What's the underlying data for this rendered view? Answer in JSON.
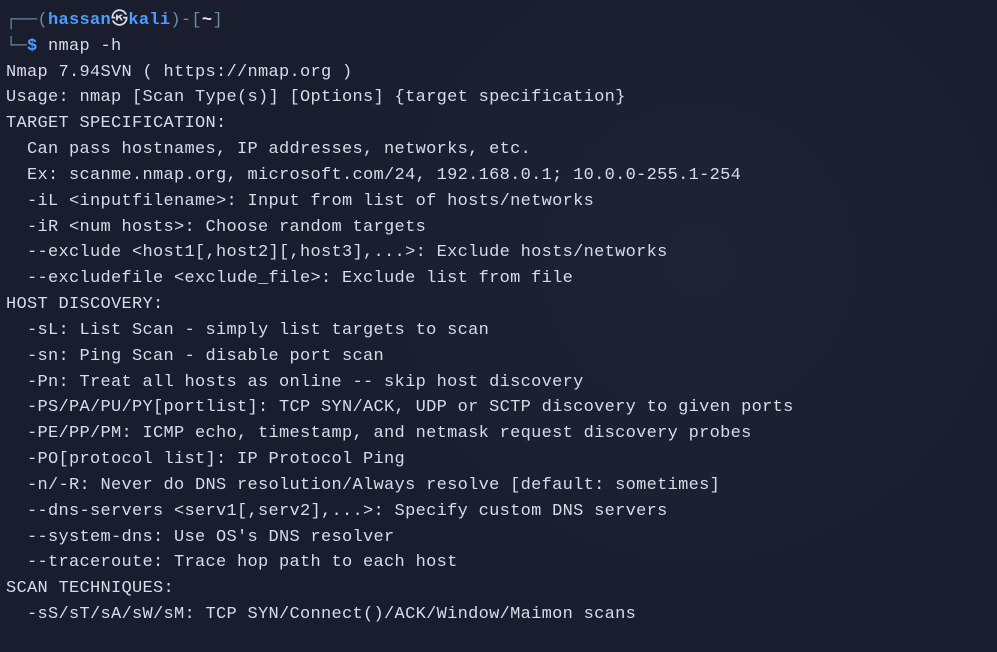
{
  "prompt": {
    "box_top_left": "┌──",
    "paren_open": "(",
    "user": "hassan",
    "skull": "㉿",
    "host": "kali",
    "paren_close": ")",
    "dash": "-",
    "brack_open": "[",
    "path": "~",
    "brack_close": "]",
    "box_bottom_left": "└─",
    "dollar": "$",
    "command": "nmap -h"
  },
  "output": {
    "l01": "Nmap 7.94SVN ( https://nmap.org )",
    "l02": "Usage: nmap [Scan Type(s)] [Options] {target specification}",
    "l03": "TARGET SPECIFICATION:",
    "l04": "  Can pass hostnames, IP addresses, networks, etc.",
    "l05": "  Ex: scanme.nmap.org, microsoft.com/24, 192.168.0.1; 10.0.0-255.1-254",
    "l06": "  -iL <inputfilename>: Input from list of hosts/networks",
    "l07": "  -iR <num hosts>: Choose random targets",
    "l08": "  --exclude <host1[,host2][,host3],...>: Exclude hosts/networks",
    "l09": "  --excludefile <exclude_file>: Exclude list from file",
    "l10": "HOST DISCOVERY:",
    "l11": "  -sL: List Scan - simply list targets to scan",
    "l12": "  -sn: Ping Scan - disable port scan",
    "l13": "  -Pn: Treat all hosts as online -- skip host discovery",
    "l14": "  -PS/PA/PU/PY[portlist]: TCP SYN/ACK, UDP or SCTP discovery to given ports",
    "l15": "  -PE/PP/PM: ICMP echo, timestamp, and netmask request discovery probes",
    "l16": "  -PO[protocol list]: IP Protocol Ping",
    "l17": "  -n/-R: Never do DNS resolution/Always resolve [default: sometimes]",
    "l18": "  --dns-servers <serv1[,serv2],...>: Specify custom DNS servers",
    "l19": "  --system-dns: Use OS's DNS resolver",
    "l20": "  --traceroute: Trace hop path to each host",
    "l21": "SCAN TECHNIQUES:",
    "l22": "  -sS/sT/sA/sW/sM: TCP SYN/Connect()/ACK/Window/Maimon scans"
  }
}
